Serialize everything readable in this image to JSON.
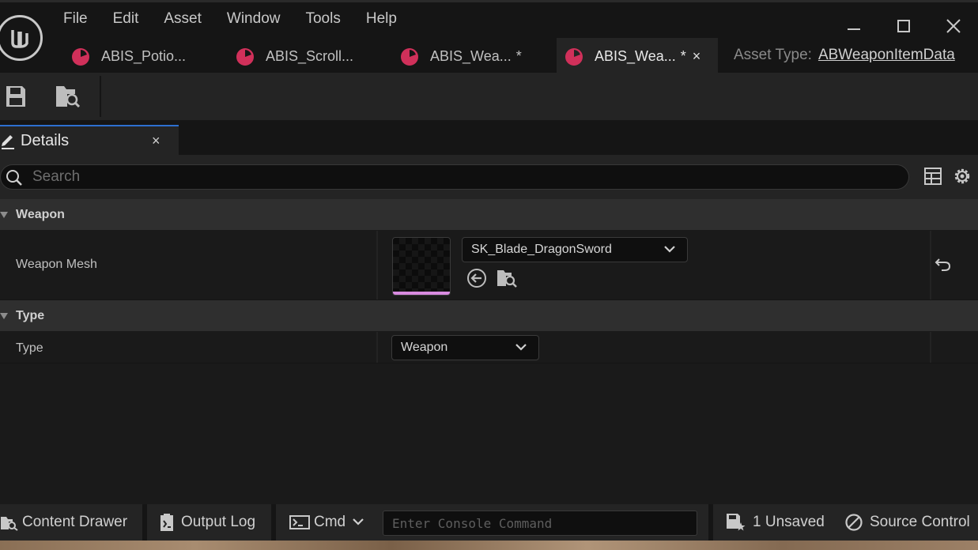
{
  "menu": [
    "File",
    "Edit",
    "Asset",
    "Window",
    "Tools",
    "Help"
  ],
  "tabs": [
    {
      "label": "ABIS_Potio...",
      "dirty": "",
      "active": false
    },
    {
      "label": "ABIS_Scroll...",
      "dirty": "",
      "active": false
    },
    {
      "label": "ABIS_Wea...",
      "dirty": "*",
      "active": false
    },
    {
      "label": "ABIS_Wea...",
      "dirty": "*",
      "active": true,
      "close": "×"
    }
  ],
  "asset_type": {
    "label": "Asset Type:",
    "value": "ABWeaponItemData"
  },
  "details": {
    "title": "Details",
    "close": "×"
  },
  "search": {
    "placeholder": "Search"
  },
  "categories": {
    "weapon": {
      "label": "Weapon",
      "prop_name": "Weapon Mesh",
      "value": "SK_Blade_DragonSword"
    },
    "type": {
      "label": "Type",
      "prop_name": "Type",
      "value": "Weapon"
    }
  },
  "statusbar": {
    "content_drawer": "Content Drawer",
    "output_log": "Output Log",
    "cmd": "Cmd",
    "console_placeholder": "Enter Console Command",
    "unsaved": "1 Unsaved",
    "source_control": "Source Control"
  },
  "colors": {
    "accent_tab": "#2d6fd0",
    "asset_icon": "#d0305a",
    "thumb_bar": "#d88be0"
  }
}
